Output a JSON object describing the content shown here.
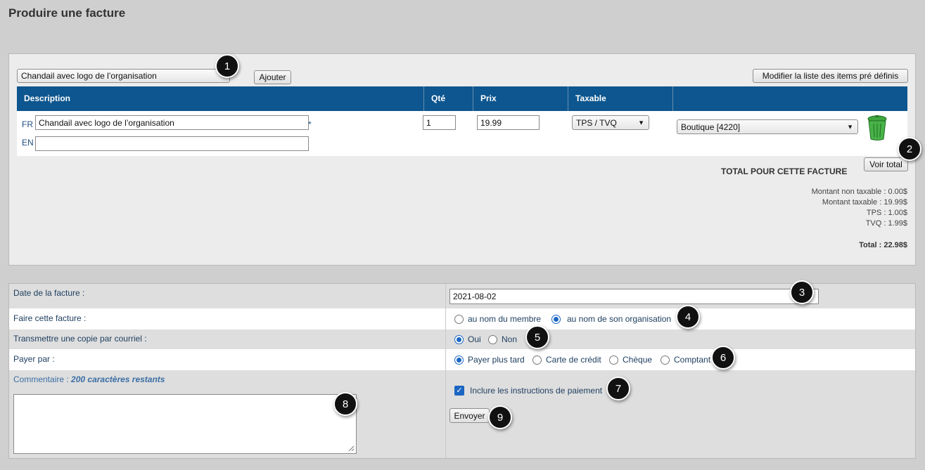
{
  "page": {
    "title": "Produire une facture"
  },
  "toolbar": {
    "item_select_value": "Chandail avec logo de l’organisation",
    "add_label": "Ajouter",
    "edit_items_label": "Modifier la liste des items pré définis"
  },
  "table": {
    "headers": [
      "Description",
      "Qté",
      "Prix",
      "Taxable"
    ],
    "row": {
      "lang_fr": "FR",
      "lang_en": "EN",
      "desc_fr": "Chandail avec logo de l’organisation",
      "desc_en": "",
      "required_mark": "*",
      "qty": "1",
      "price": "19.99",
      "taxable": "TPS / TVQ",
      "account": "Boutique [4220]"
    }
  },
  "totals": {
    "show_total_label": "Voir total",
    "title": "TOTAL POUR CETTE FACTURE",
    "non_taxable": "Montant non taxable : 0.00$",
    "taxable": "Montant taxable : 19.99$",
    "tps": "TPS : 1.00$",
    "tvq": "TVQ : 1.99$",
    "total": "Total : 22.98$"
  },
  "form": {
    "date_label": "Date de la facture :",
    "date_value": "2021-08-02",
    "make_for_label": "Faire cette facture :",
    "make_for_options": [
      "au nom du membre",
      "au nom de son organisation"
    ],
    "make_for_selected": 1,
    "email_copy_label": "Transmettre une copie par courriel :",
    "email_copy_options": [
      "Oui",
      "Non"
    ],
    "email_copy_selected": 0,
    "pay_by_label": "Payer par :",
    "pay_by_options": [
      "Payer plus tard",
      "Carte de crédit",
      "Chèque",
      "Comptant"
    ],
    "pay_by_selected": 0,
    "comment_label": "Commentaire :",
    "comment_remaining": "200 caractères restants",
    "include_instructions_label": "Inclure les instructions de paiement",
    "include_instructions_checked": true,
    "submit_label": "Envoyer"
  },
  "callouts": [
    "1",
    "2",
    "3",
    "4",
    "5",
    "6",
    "7",
    "8",
    "9"
  ],
  "colors": {
    "header": "#0d568f",
    "accent": "#1a66c2",
    "callout": "#111111"
  },
  "icons": {
    "trash": "trash-icon",
    "chevron": "chevron-down-icon",
    "check": "check-icon"
  }
}
